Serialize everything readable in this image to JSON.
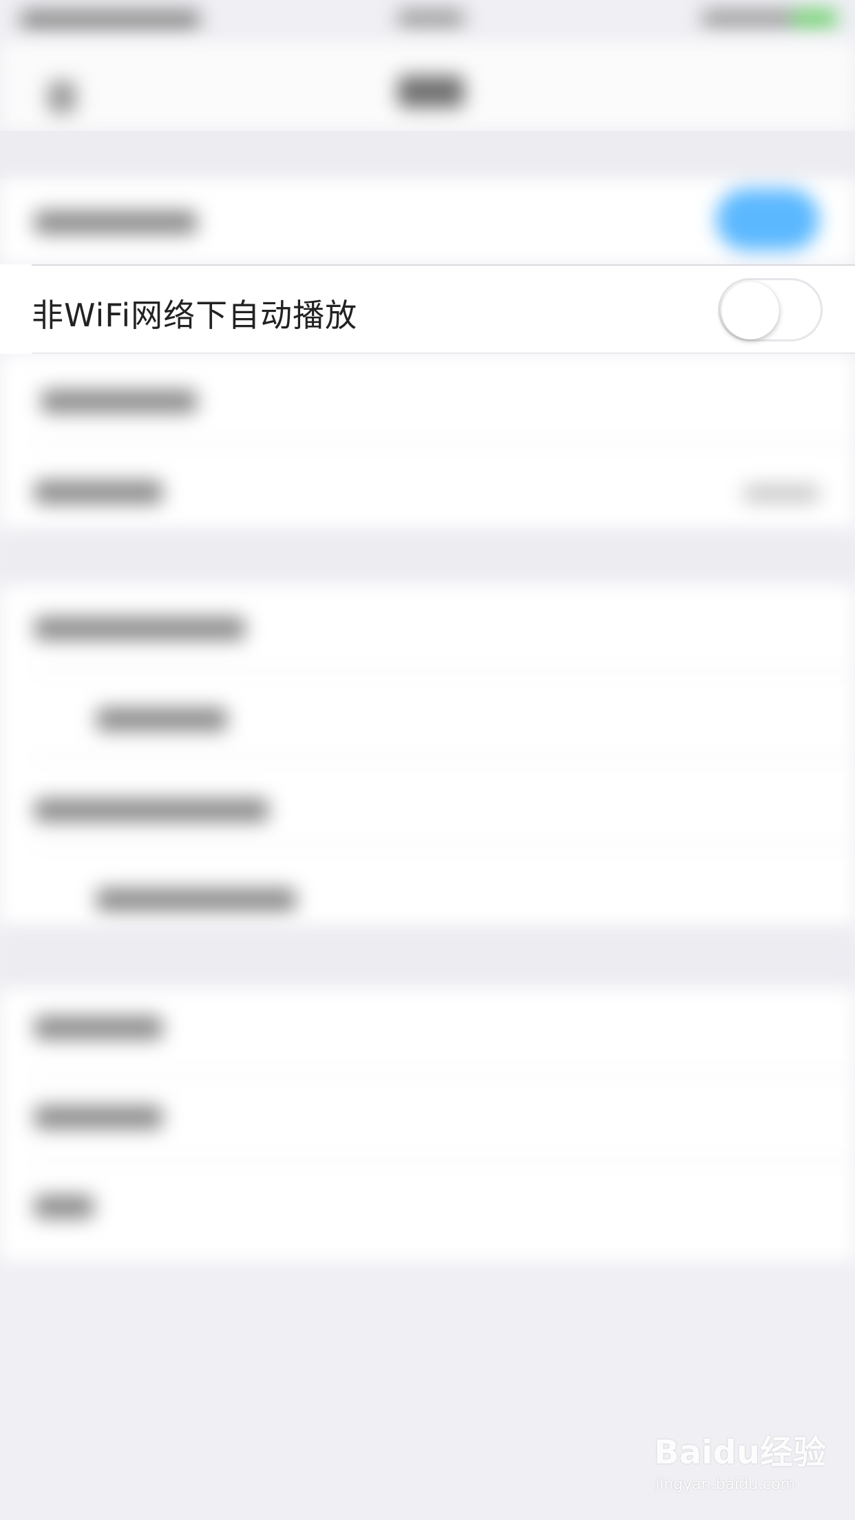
{
  "settings_row": {
    "label": "非WiFi网络下自动播放",
    "toggle_state": "off"
  },
  "watermark": {
    "logo": "Baidu经验",
    "url": "jingyan.baidu.com"
  },
  "colors": {
    "accent_toggle": "#5bb8ff",
    "background": "#efeff4"
  }
}
